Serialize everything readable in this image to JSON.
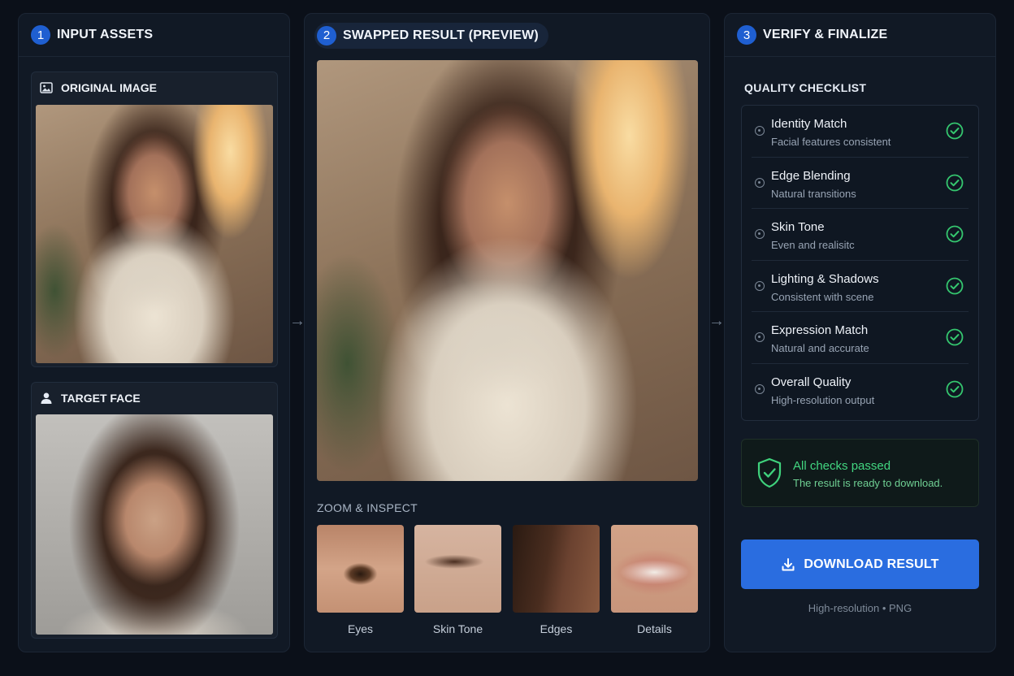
{
  "panels": [
    {
      "step": "1",
      "title": "INPUT ASSETS"
    },
    {
      "step": "2",
      "title": "SWAPPED RESULT (PREVIEW)"
    },
    {
      "step": "3",
      "title": "VERIFY & FINALIZE"
    }
  ],
  "inputs": {
    "original_label": "ORIGINAL IMAGE",
    "target_label": "TARGET FACE"
  },
  "zoom": {
    "heading": "ZOOM & INSPECT",
    "items": [
      "Eyes",
      "Skin Tone",
      "Edges",
      "Details"
    ]
  },
  "checklist": {
    "heading": "QUALITY CHECKLIST",
    "items": [
      {
        "title": "Identity Match",
        "sub": "Facial features consistent"
      },
      {
        "title": "Edge Blending",
        "sub": "Natural transitions"
      },
      {
        "title": "Skin Tone",
        "sub": "Even and realisitc"
      },
      {
        "title": "Lighting & Shadows",
        "sub": "Consistent with scene"
      },
      {
        "title": "Expression Match",
        "sub": "Natural and accurate"
      },
      {
        "title": "Overall Quality",
        "sub": "High-resolution output"
      }
    ]
  },
  "status": {
    "title": "All checks passed",
    "sub": "The result is ready to download."
  },
  "download": {
    "label": "DOWNLOAD RESULT",
    "note": "High-resolution • PNG"
  },
  "icons": {
    "image": "image-icon",
    "user": "user-icon",
    "arrow": "arrow-right-icon",
    "check": "check-circle-icon",
    "shield": "shield-check-icon",
    "download": "download-icon"
  },
  "colors": {
    "accent": "#2a6de0",
    "success": "#42d680",
    "background": "#0b1019",
    "panel": "#111925"
  }
}
